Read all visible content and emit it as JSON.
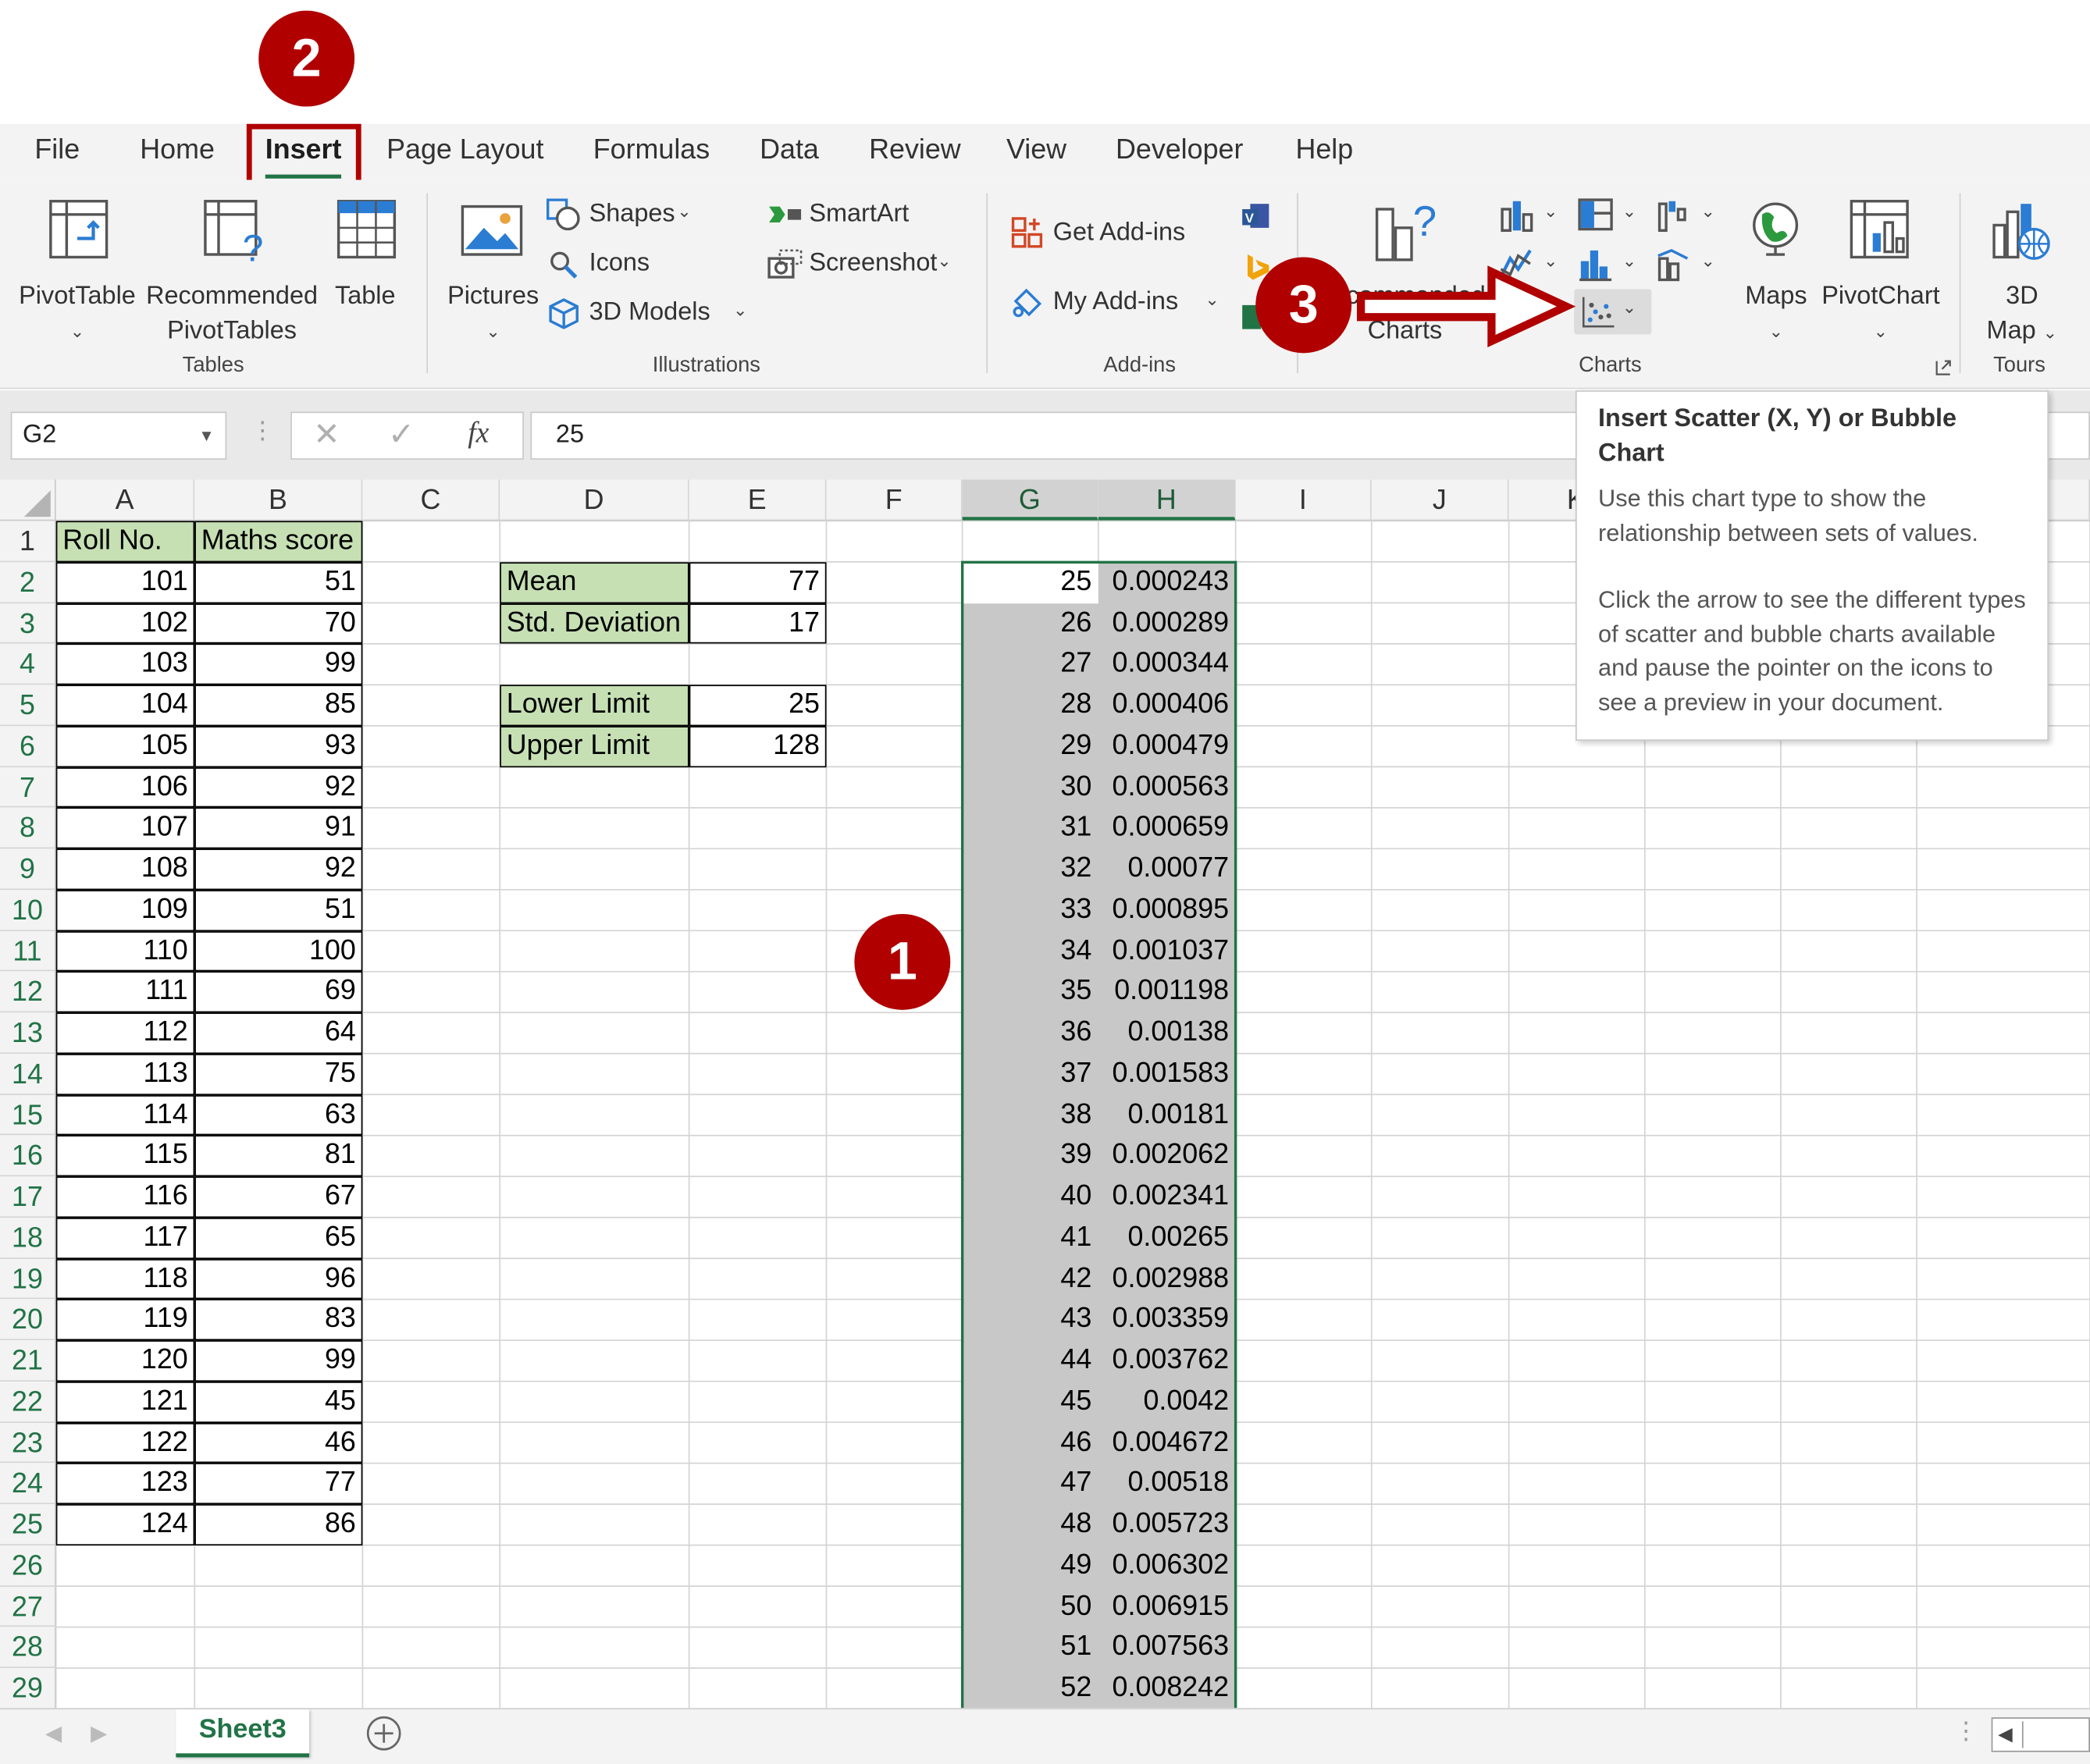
{
  "ribbon_tabs": [
    "File",
    "Home",
    "Insert",
    "Page Layout",
    "Formulas",
    "Data",
    "Review",
    "View",
    "Developer",
    "Help"
  ],
  "active_tab": "Insert",
  "groups": {
    "tables": {
      "label": "Tables",
      "pivot_table": "PivotTable",
      "recommended_line1": "Recommended",
      "recommended_line2": "PivotTables",
      "table": "Table"
    },
    "illustrations": {
      "label": "Illustrations",
      "pictures": "Pictures",
      "shapes": "Shapes",
      "icons": "Icons",
      "models": "3D Models",
      "smartart": "SmartArt",
      "screenshot": "Screenshot"
    },
    "addins": {
      "label": "Add-ins",
      "get": "Get Add-ins",
      "my": "My Add-ins"
    },
    "charts": {
      "label": "Charts",
      "recommended_line1": "commended",
      "recommended_line2": "Charts",
      "maps": "Maps",
      "pivotchart": "PivotChart"
    },
    "tours": {
      "label": "Tours",
      "map_line1": "3D",
      "map_line2": "Map"
    }
  },
  "formula_bar": {
    "name_box": "G2",
    "fx": "fx",
    "value": "25"
  },
  "columns": [
    "A",
    "B",
    "C",
    "D",
    "E",
    "F",
    "G",
    "H",
    "I",
    "J",
    "K"
  ],
  "rows": [
    "1",
    "2",
    "3",
    "4",
    "5",
    "6",
    "7",
    "8",
    "9",
    "10",
    "11",
    "12",
    "13",
    "14",
    "15",
    "16",
    "17",
    "18",
    "19",
    "20",
    "21",
    "22",
    "23",
    "24",
    "25",
    "26",
    "27",
    "28",
    "29"
  ],
  "headers": {
    "roll": "Roll No.",
    "maths": "Maths score"
  },
  "roll_no": [
    "101",
    "102",
    "103",
    "104",
    "105",
    "106",
    "107",
    "108",
    "109",
    "110",
    "111",
    "112",
    "113",
    "114",
    "115",
    "116",
    "117",
    "118",
    "119",
    "120",
    "121",
    "122",
    "123",
    "124"
  ],
  "maths_score": [
    "51",
    "70",
    "99",
    "85",
    "93",
    "92",
    "91",
    "92",
    "51",
    "100",
    "69",
    "64",
    "75",
    "63",
    "81",
    "67",
    "65",
    "96",
    "83",
    "99",
    "45",
    "46",
    "77",
    "86"
  ],
  "stats": [
    {
      "label": "Mean",
      "value": "77"
    },
    {
      "label": "Std. Deviation",
      "value": "17"
    },
    {
      "label": "Lower Limit",
      "value": "25"
    },
    {
      "label": "Upper Limit",
      "value": "128"
    }
  ],
  "col_g": [
    "25",
    "26",
    "27",
    "28",
    "29",
    "30",
    "31",
    "32",
    "33",
    "34",
    "35",
    "36",
    "37",
    "38",
    "39",
    "40",
    "41",
    "42",
    "43",
    "44",
    "45",
    "46",
    "47",
    "48",
    "49",
    "50",
    "51",
    "52"
  ],
  "col_h": [
    "0.000243",
    "0.000289",
    "0.000344",
    "0.000406",
    "0.000479",
    "0.000563",
    "0.000659",
    "0.00077",
    "0.000895",
    "0.001037",
    "0.001198",
    "0.00138",
    "0.001583",
    "0.00181",
    "0.002062",
    "0.002341",
    "0.00265",
    "0.002988",
    "0.003359",
    "0.003762",
    "0.0042",
    "0.004672",
    "0.00518",
    "0.005723",
    "0.006302",
    "0.006915",
    "0.007563",
    "0.008242"
  ],
  "tooltip": {
    "title": "Insert Scatter (X, Y) or Bubble Chart",
    "line1": "Use this chart type to show the relationship between sets of values.",
    "line2": "Click the arrow to see the different types of scatter and bubble charts available and pause the pointer on the icons to see a preview in your document."
  },
  "badges": [
    "1",
    "2",
    "3"
  ],
  "sheet_tab": "Sheet3",
  "colors": {
    "highlight": "#b00000",
    "header_fill": "#c6e0b4",
    "selection": "#217346",
    "selected_fill": "#c8c8c8"
  }
}
